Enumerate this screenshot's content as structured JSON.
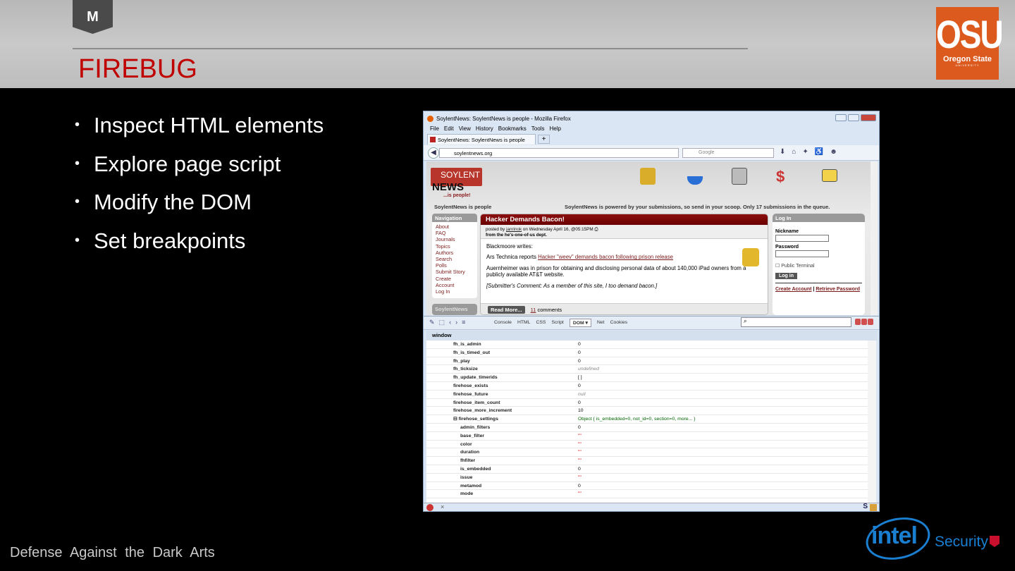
{
  "slide": {
    "title": "FIREBUG",
    "bullets": [
      "Inspect HTML elements",
      "Explore page script",
      "Modify the DOM",
      "Set breakpoints"
    ],
    "footer": "Defense Against the Dark Arts",
    "logos": {
      "mcafee": "M",
      "osu_big": "OSU",
      "osu_name": "Oregon State",
      "osu_sub": "UNIVERSITY",
      "intel": "intel",
      "intel_security": "Security"
    },
    "colors": {
      "title": "#c00000",
      "osu": "#dc5a1e",
      "intel": "#1a7fd0"
    }
  },
  "browser": {
    "window_title": "SoylentNews: SoylentNews is people - Mozilla Firefox",
    "menu": [
      "File",
      "Edit",
      "View",
      "History",
      "Bookmarks",
      "Tools",
      "Help"
    ],
    "tab_label": "SoylentNews: SoylentNews is people",
    "new_tab": "+",
    "url": "soylentnews.org",
    "search_placeholder": "Google",
    "page": {
      "logo_top": "SOYLENT",
      "logo_bottom": "NEWS",
      "logo_tag": "...is people!",
      "tagline": "SoylentNews is people",
      "powered": "SoylentNews is powered by your submissions, so send in your scoop. Only 17 submissions in the queue.",
      "nav_header": "Navigation",
      "nav_items": [
        "About",
        "FAQ",
        "Journals",
        "Topics",
        "Authors",
        "Search",
        "Polls",
        "Submit Story",
        "Create",
        "Account",
        "Log In"
      ],
      "nav_footer_box": "SoylentNews",
      "story": {
        "title": "Hacker Demands Bacon!",
        "posted_prefix": "posted by ",
        "author": "janrinok",
        "posted_suffix": " on Wednesday April 16, @05:15PM",
        "dept": "from the he's-one-of-us dept.",
        "p1": "Blackmoore writes:",
        "p2_prefix": "Ars Technica reports ",
        "p2_link": "Hacker \"weev\" demands bacon following prison release",
        "p3": "Auernheimer was in prison for obtaining and disclosing personal data of about 140,000 iPad owners from a publicly available AT&T website.",
        "p4": "[Submitter's Comment: As a member of this site, I too demand bacon.]",
        "read_more": "Read More...",
        "comments_count": "11",
        "comments_label": " comments"
      },
      "login": {
        "header": "Log In",
        "nickname_label": "Nickname",
        "password_label": "Password",
        "public_terminal": "Public Terminal",
        "button": "Log in",
        "create_account": "Create Account",
        "separator": "|",
        "retrieve_password": "Retrieve Password"
      }
    },
    "firebug": {
      "tabs": [
        "Console",
        "HTML",
        "CSS",
        "Script",
        "DOM ▾",
        "Net",
        "Cookies"
      ],
      "active_tab": "DOM ▾",
      "breadcrumb": "window",
      "rows": [
        {
          "k": "fh_is_admin",
          "v": "0",
          "t": "n"
        },
        {
          "k": "fh_is_timed_out",
          "v": "0",
          "t": "n"
        },
        {
          "k": "fh_play",
          "v": "0",
          "t": "n"
        },
        {
          "k": "fh_ticksize",
          "v": "undefined",
          "t": "u"
        },
        {
          "k": "fh_update_timerids",
          "v": "[ ]",
          "t": "n"
        },
        {
          "k": "firehose_exists",
          "v": "0",
          "t": "n"
        },
        {
          "k": "firehose_future",
          "v": "null",
          "t": "u"
        },
        {
          "k": "firehose_item_count",
          "v": "0",
          "t": "n"
        },
        {
          "k": "firehose_more_increment",
          "v": "10",
          "t": "n"
        },
        {
          "k": "⊟ firehose_settings",
          "v": "Object { is_embedded=0,  not_id=0,  section=0,  more... }",
          "t": "o"
        },
        {
          "k": "admin_filters",
          "v": "0",
          "t": "n",
          "ind": true
        },
        {
          "k": "base_filter",
          "v": "\"\"",
          "t": "s",
          "ind": true
        },
        {
          "k": "color",
          "v": "\"\"",
          "t": "s",
          "ind": true
        },
        {
          "k": "duration",
          "v": "\"\"",
          "t": "s",
          "ind": true
        },
        {
          "k": "fhfilter",
          "v": "\"\"",
          "t": "s",
          "ind": true
        },
        {
          "k": "is_embedded",
          "v": "0",
          "t": "n",
          "ind": true
        },
        {
          "k": "issue",
          "v": "\"\"",
          "t": "s",
          "ind": true
        },
        {
          "k": "metamod",
          "v": "0",
          "t": "n",
          "ind": true
        },
        {
          "k": "mode",
          "v": "\"\"",
          "t": "s",
          "ind": true
        }
      ]
    },
    "status_close": "×",
    "status_s": "S"
  }
}
